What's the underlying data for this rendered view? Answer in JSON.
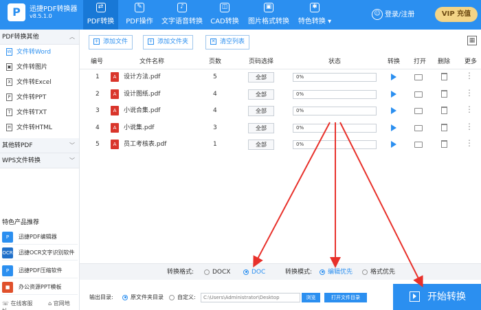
{
  "app": {
    "title": "迅捷PDF转换器",
    "version": "v8.5.1.0",
    "logo_glyph": "P"
  },
  "tabs": [
    {
      "label": "PDF转换",
      "icon": "pdf-convert-icon"
    },
    {
      "label": "PDF操作",
      "icon": "pdf-operate-icon"
    },
    {
      "label": "文字语音转换",
      "icon": "text-speech-icon"
    },
    {
      "label": "CAD转换",
      "icon": "cad-icon"
    },
    {
      "label": "图片格式转换",
      "icon": "image-icon"
    },
    {
      "label": "特色转换 ▾",
      "icon": "feature-icon"
    }
  ],
  "header": {
    "login_label": "登录/注册",
    "vip_label": "VIP 充值"
  },
  "sidebar": {
    "section1": "PDF转换其他",
    "items": [
      "文件转Word",
      "文件转图片",
      "文件转Excel",
      "文件转PPT",
      "文件转TXT",
      "文件转HTML"
    ],
    "section2": "其他转PDF",
    "section3": "WPS文件转换",
    "featured_label": "特色产品推荐",
    "featured": [
      {
        "label": "迅捷PDF编辑器",
        "color": "#2b8ff0",
        "glyph": "P"
      },
      {
        "label": "迅捷OCR文字识别软件",
        "color": "#1f6fc9",
        "glyph": "OCR"
      },
      {
        "label": "迅捷PDF压缩软件",
        "color": "#2b8ff0",
        "glyph": "P"
      },
      {
        "label": "办公资源PPT模板",
        "color": "#e0502b",
        "glyph": "■"
      }
    ],
    "bottom": {
      "support": "在线客服",
      "website": "官网地址"
    }
  },
  "toolbar": {
    "add_file": "添加文件",
    "add_folder": "添加文件夹",
    "clear": "清空列表"
  },
  "table": {
    "headers": [
      "编号",
      "文件名称",
      "页数",
      "页码选择",
      "状态",
      "转换",
      "打开",
      "删除",
      "更多"
    ],
    "rows": [
      {
        "num": "1",
        "name": "设计方法.pdf",
        "pages": "5",
        "page_sel": "全部",
        "status": "0%"
      },
      {
        "num": "2",
        "name": "设计图纸.pdf",
        "pages": "4",
        "page_sel": "全部",
        "status": "0%"
      },
      {
        "num": "3",
        "name": "小说合集.pdf",
        "pages": "4",
        "page_sel": "全部",
        "status": "0%"
      },
      {
        "num": "4",
        "name": "小说集.pdf",
        "pages": "3",
        "page_sel": "全部",
        "status": "0%"
      },
      {
        "num": "5",
        "name": "员工考核表.pdf",
        "pages": "1",
        "page_sel": "全部",
        "status": "0%"
      }
    ]
  },
  "format": {
    "format_label": "转换格式:",
    "opt_docx": "DOCX",
    "opt_doc": "DOC",
    "mode_label": "转换模式:",
    "opt_edit": "编辑优先",
    "opt_layout": "格式优先",
    "selected_format": "DOC",
    "selected_mode": "编辑优先"
  },
  "output": {
    "label": "输出目录:",
    "opt_original": "原文件夹目录",
    "opt_custom": "自定义:",
    "path": "C:\\Users\\Administrator\\Desktop",
    "browse": "浏览",
    "open_folder": "打开文件目录"
  },
  "start_label": "开始转换",
  "colors": {
    "primary": "#2b8ff0",
    "pdf_red": "#d9352b",
    "vip_gold": "#f3d487",
    "arrow_red": "#e8302a"
  }
}
